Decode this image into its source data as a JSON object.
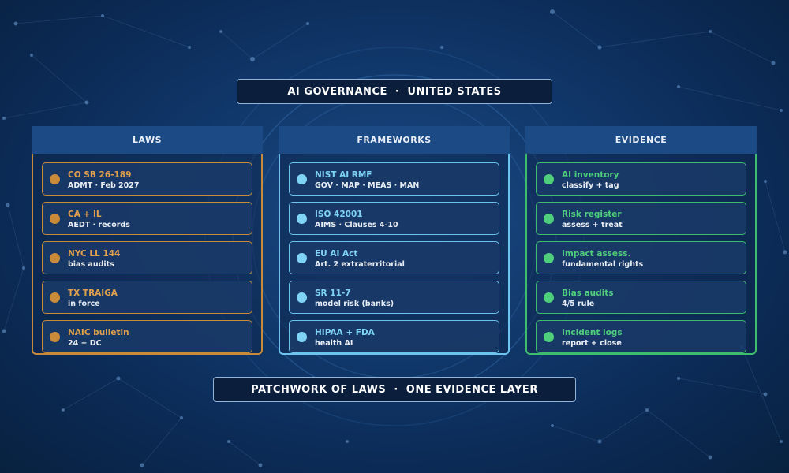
{
  "banner_top": "AI GOVERNANCE  ·  UNITED STATES",
  "banner_bottom": "PATCHWORK OF LAWS  ·  ONE EVIDENCE LAYER",
  "columns": [
    {
      "header": "LAWS",
      "accent": "#c98a3a",
      "items": [
        {
          "title": "CO SB 26-189",
          "sub": "ADMT · Feb 2027"
        },
        {
          "title": "CA + IL",
          "sub": "AEDT · records"
        },
        {
          "title": "NYC LL 144",
          "sub": "bias audits"
        },
        {
          "title": "TX TRAIGA",
          "sub": "in force"
        },
        {
          "title": "NAIC bulletin",
          "sub": "24 + DC"
        }
      ]
    },
    {
      "header": "FRAMEWORKS",
      "accent": "#6cc4ee",
      "items": [
        {
          "title": "NIST AI RMF",
          "sub": "GOV · MAP · MEAS · MAN"
        },
        {
          "title": "ISO 42001",
          "sub": "AIMS · Clauses 4-10"
        },
        {
          "title": "EU AI Act",
          "sub": "Art. 2 extraterritorial"
        },
        {
          "title": "SR 11-7",
          "sub": "model risk (banks)"
        },
        {
          "title": "HIPAA + FDA",
          "sub": "health AI"
        }
      ]
    },
    {
      "header": "EVIDENCE",
      "accent": "#3fbd6e",
      "items": [
        {
          "title": "AI inventory",
          "sub": "classify + tag"
        },
        {
          "title": "Risk register",
          "sub": "assess + treat"
        },
        {
          "title": "Impact assess.",
          "sub": "fundamental rights"
        },
        {
          "title": "Bias audits",
          "sub": "4/5 rule"
        },
        {
          "title": "Incident logs",
          "sub": "report + close"
        }
      ]
    }
  ]
}
